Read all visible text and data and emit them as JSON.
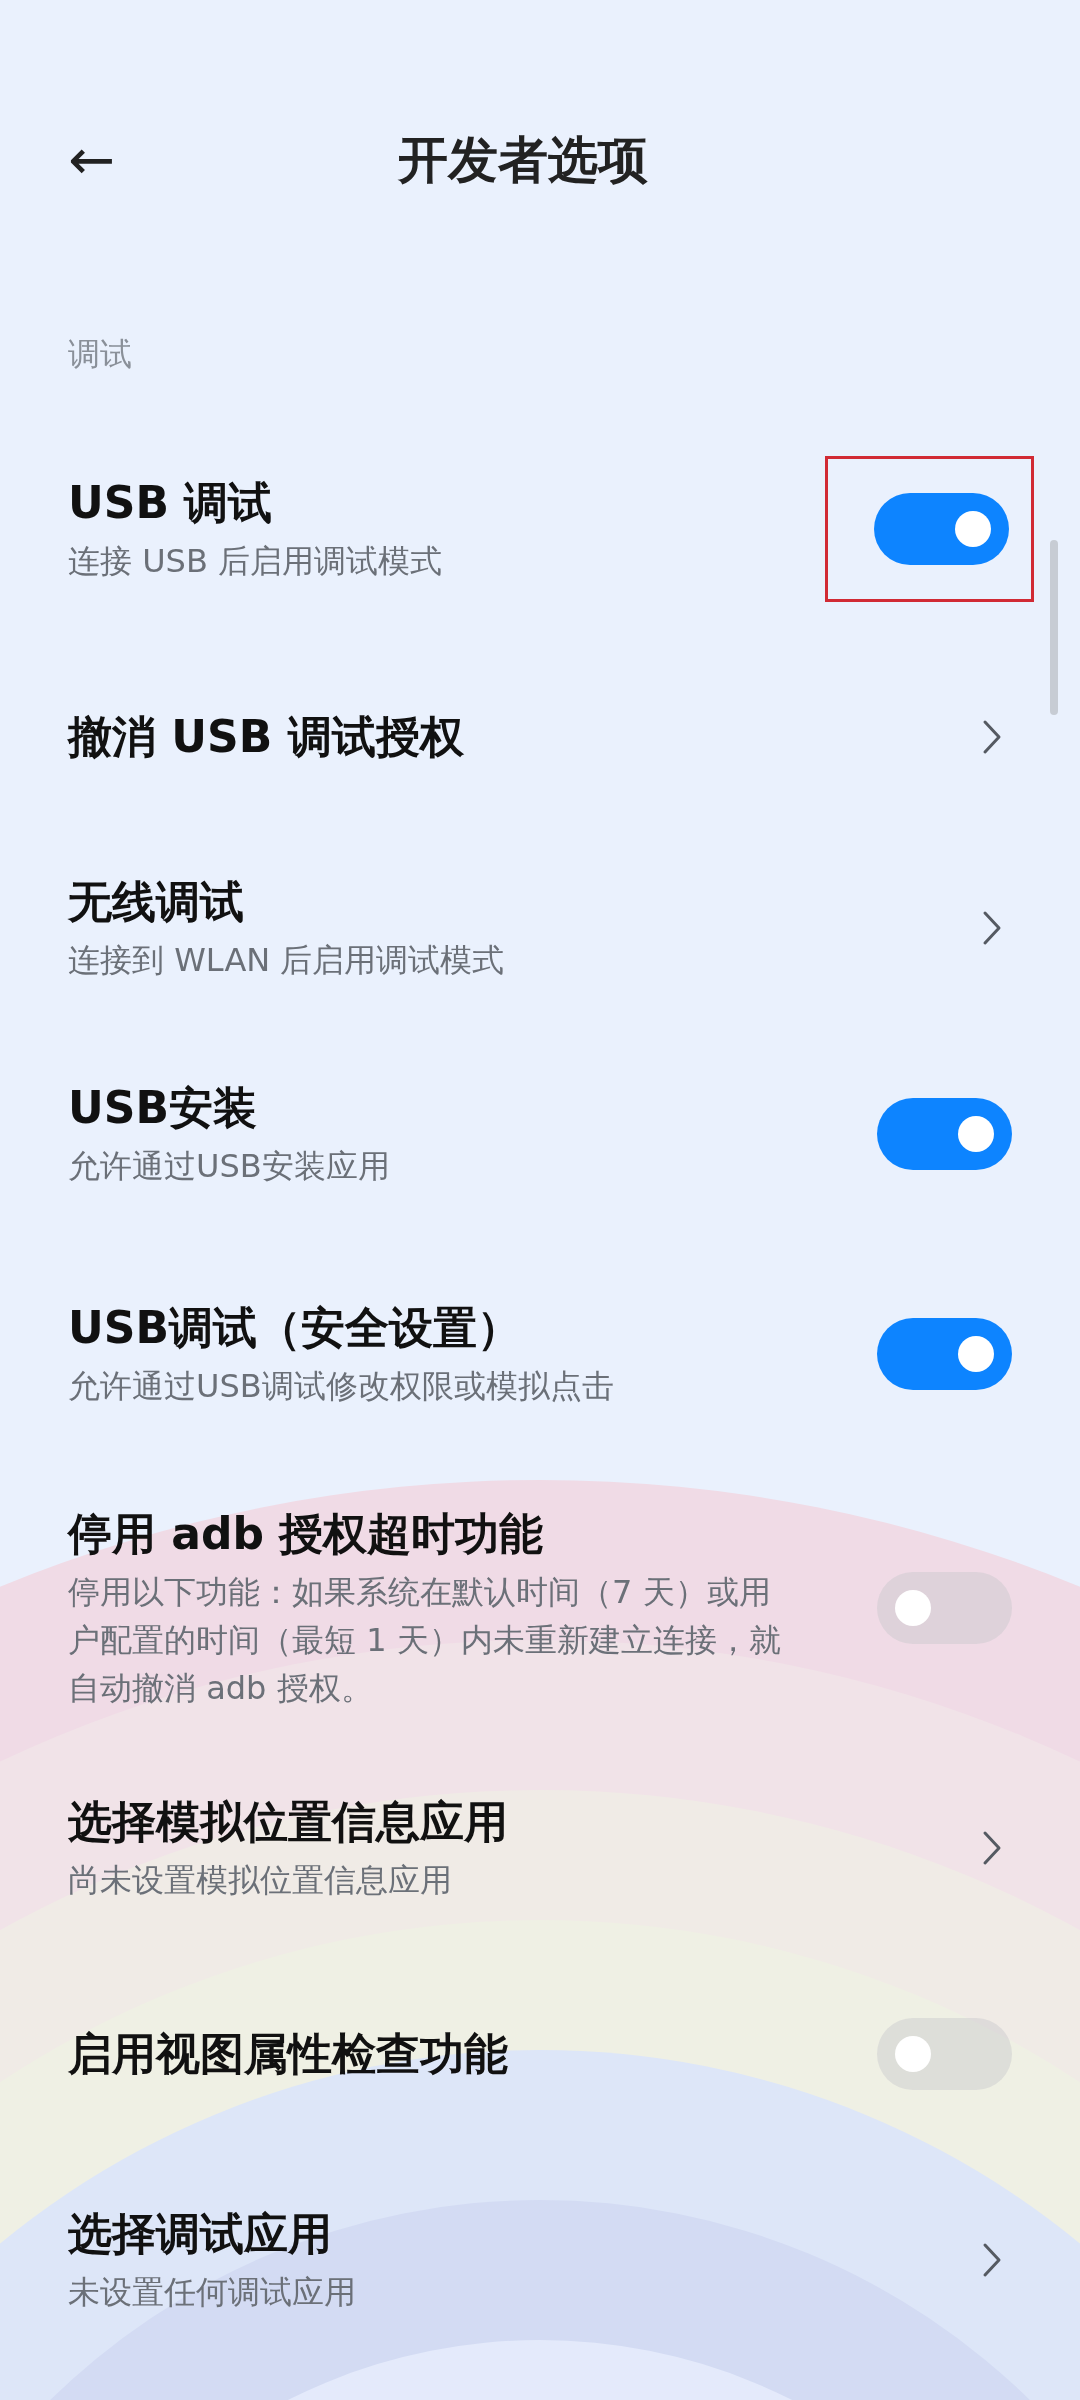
{
  "header": {
    "back_icon": "←",
    "title": "开发者选项"
  },
  "section": {
    "label": "调试"
  },
  "items": [
    {
      "kind": "switch",
      "title": "USB 调试",
      "subtitle": "连接 USB 后启用调试模式",
      "on": true,
      "highlighted": true
    },
    {
      "kind": "link",
      "title": "撤消 USB 调试授权",
      "highlighted": false
    },
    {
      "kind": "link",
      "title": "无线调试",
      "subtitle": "连接到 WLAN 后启用调试模式",
      "highlighted": false
    },
    {
      "kind": "switch",
      "title": "USB安装",
      "subtitle": "允许通过USB安装应用",
      "on": true,
      "highlighted": false
    },
    {
      "kind": "switch",
      "title": "USB调试（安全设置）",
      "subtitle": "允许通过USB调试修改权限或模拟点击",
      "on": true,
      "highlighted": false
    },
    {
      "kind": "switch",
      "title": "停用 adb 授权超时功能",
      "subtitle": "停用以下功能：如果系统在默认时间（7 天）或用户配置的时间（最短 1 天）内未重新建立连接，就自动撤消 adb 授权。",
      "on": false,
      "highlighted": false
    },
    {
      "kind": "link",
      "title": "选择模拟位置信息应用",
      "subtitle": "尚未设置模拟位置信息应用",
      "highlighted": false
    },
    {
      "kind": "switch",
      "title": "启用视图属性检查功能",
      "on": false,
      "highlighted": false
    },
    {
      "kind": "link",
      "title": "选择调试应用",
      "subtitle": "未设置任何调试应用",
      "highlighted": false
    }
  ]
}
